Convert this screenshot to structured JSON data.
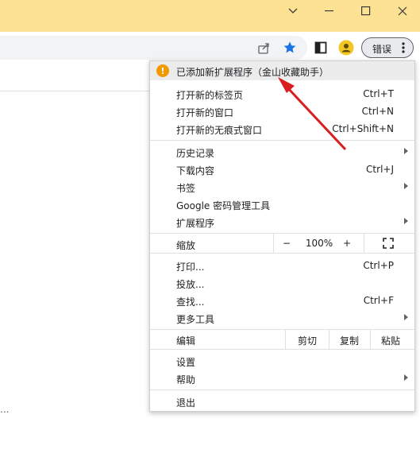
{
  "window": {
    "minimize_glyph": "—",
    "restore_glyph": "☐",
    "close_glyph": "✕"
  },
  "toolbar": {
    "profile_label": "错误"
  },
  "menu": {
    "notice": "已添加新扩展程序（金山收藏助手）",
    "new_tab": "打开新的标签页",
    "new_tab_shortcut": "Ctrl+T",
    "new_window": "打开新的窗口",
    "new_window_shortcut": "Ctrl+N",
    "incognito": "打开新的无痕式窗口",
    "incognito_shortcut": "Ctrl+Shift+N",
    "history": "历史记录",
    "downloads": "下载内容",
    "downloads_shortcut": "Ctrl+J",
    "bookmarks": "书签",
    "password_manager": "Google 密码管理工具",
    "extensions": "扩展程序",
    "zoom_label": "缩放",
    "zoom_minus": "−",
    "zoom_value": "100%",
    "zoom_plus": "+",
    "print": "打印...",
    "print_shortcut": "Ctrl+P",
    "cast": "投放...",
    "find": "查找...",
    "find_shortcut": "Ctrl+F",
    "more_tools": "更多工具",
    "edit_label": "编辑",
    "cut": "剪切",
    "copy": "复制",
    "paste": "粘贴",
    "settings": "设置",
    "help": "帮助",
    "exit": "退出"
  },
  "page": {
    "ellipsis": "..."
  }
}
